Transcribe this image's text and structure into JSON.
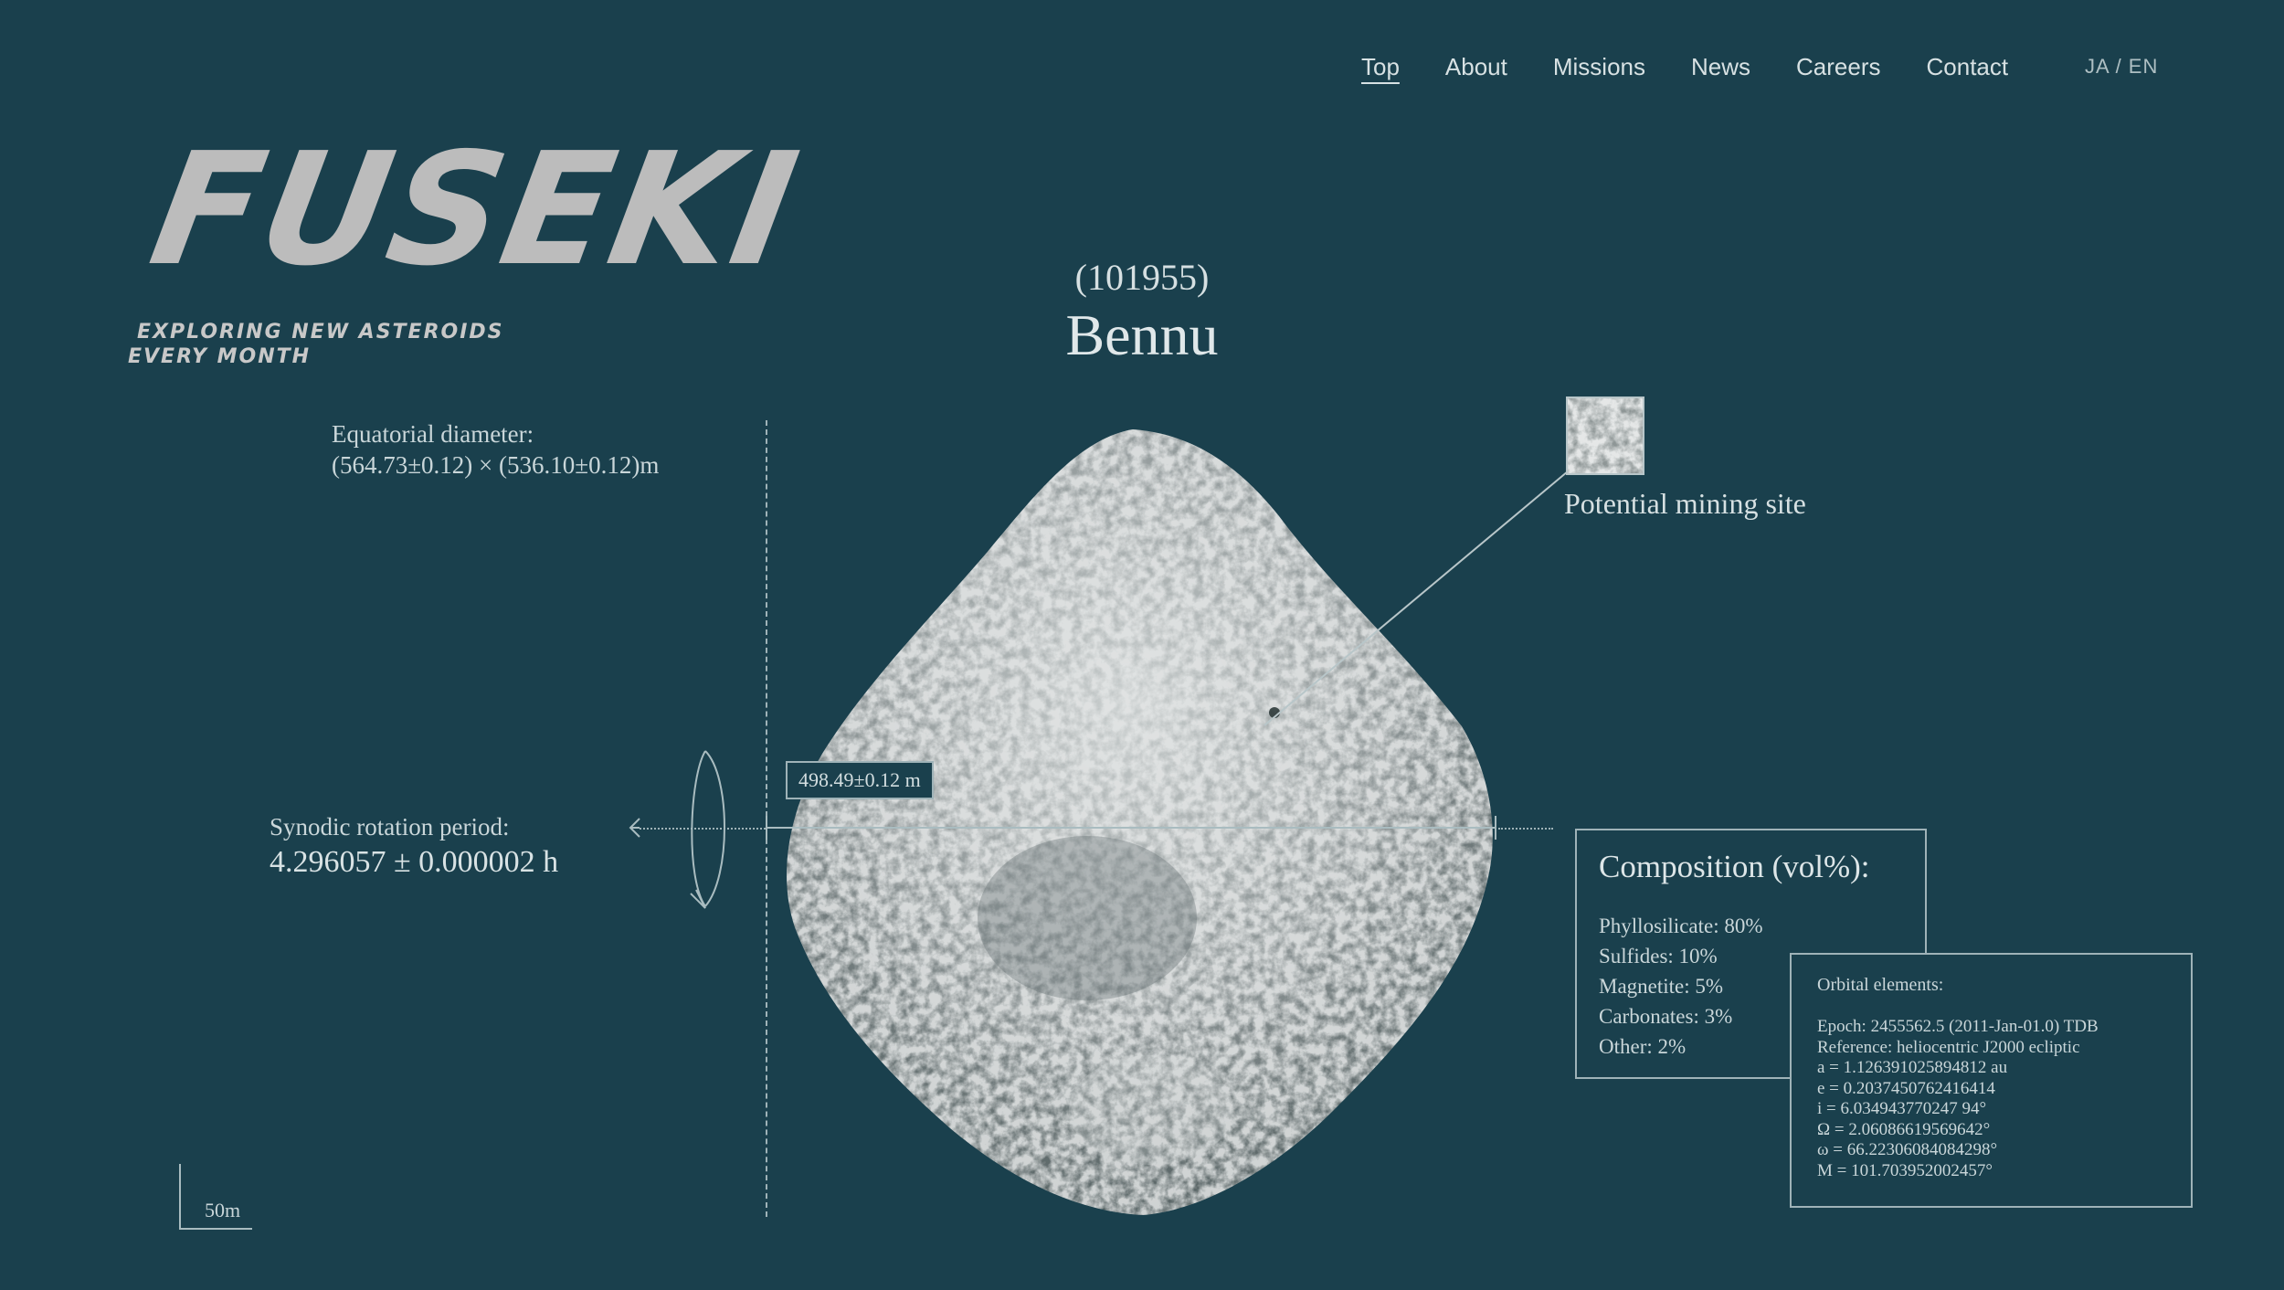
{
  "nav": {
    "items": [
      "Top",
      "About",
      "Missions",
      "News",
      "Careers",
      "Contact"
    ],
    "active": "Top",
    "lang": "JA / EN"
  },
  "logo": {
    "wordmark": "FUSEKI",
    "tagline_line1": "EXPLORING NEW ASTEROIDS",
    "tagline_line2": "EVERY MONTH"
  },
  "asteroid": {
    "designation": "(101955)",
    "name": "Bennu",
    "diameter_label": "Equatorial diameter:",
    "diameter_value": "(564.73±0.12) × (536.10±0.12)m",
    "width_measure": "498.49±0.12 m",
    "rotation_label": "Synodic rotation period:",
    "rotation_value": "4.296057 ± 0.000002 h",
    "mining_label": "Potential mining site",
    "scale_label": "50m"
  },
  "composition": {
    "title": "Composition (vol%):",
    "items": [
      "Phyllosilicate: 80%",
      "Sulfides: 10%",
      "Magnetite: 5%",
      "Carbonates: 3%",
      "Other: 2%"
    ]
  },
  "orbital": {
    "title": "Orbital elements:",
    "lines": [
      "Epoch: 2455562.5 (2011-Jan-01.0) TDB",
      "Reference: heliocentric J2000 ecliptic",
      "a = 1.126391025894812 au",
      "e = 0.2037450762416414",
      "i = 6.034943770247 94°",
      "Ω = 2.06086619569642°",
      "ω = 66.22306084084298°",
      "M = 101.703952002457°"
    ]
  },
  "colors": {
    "background": "#1a404d",
    "text": "#c9d6d9",
    "logo": "#bcbcbc"
  }
}
